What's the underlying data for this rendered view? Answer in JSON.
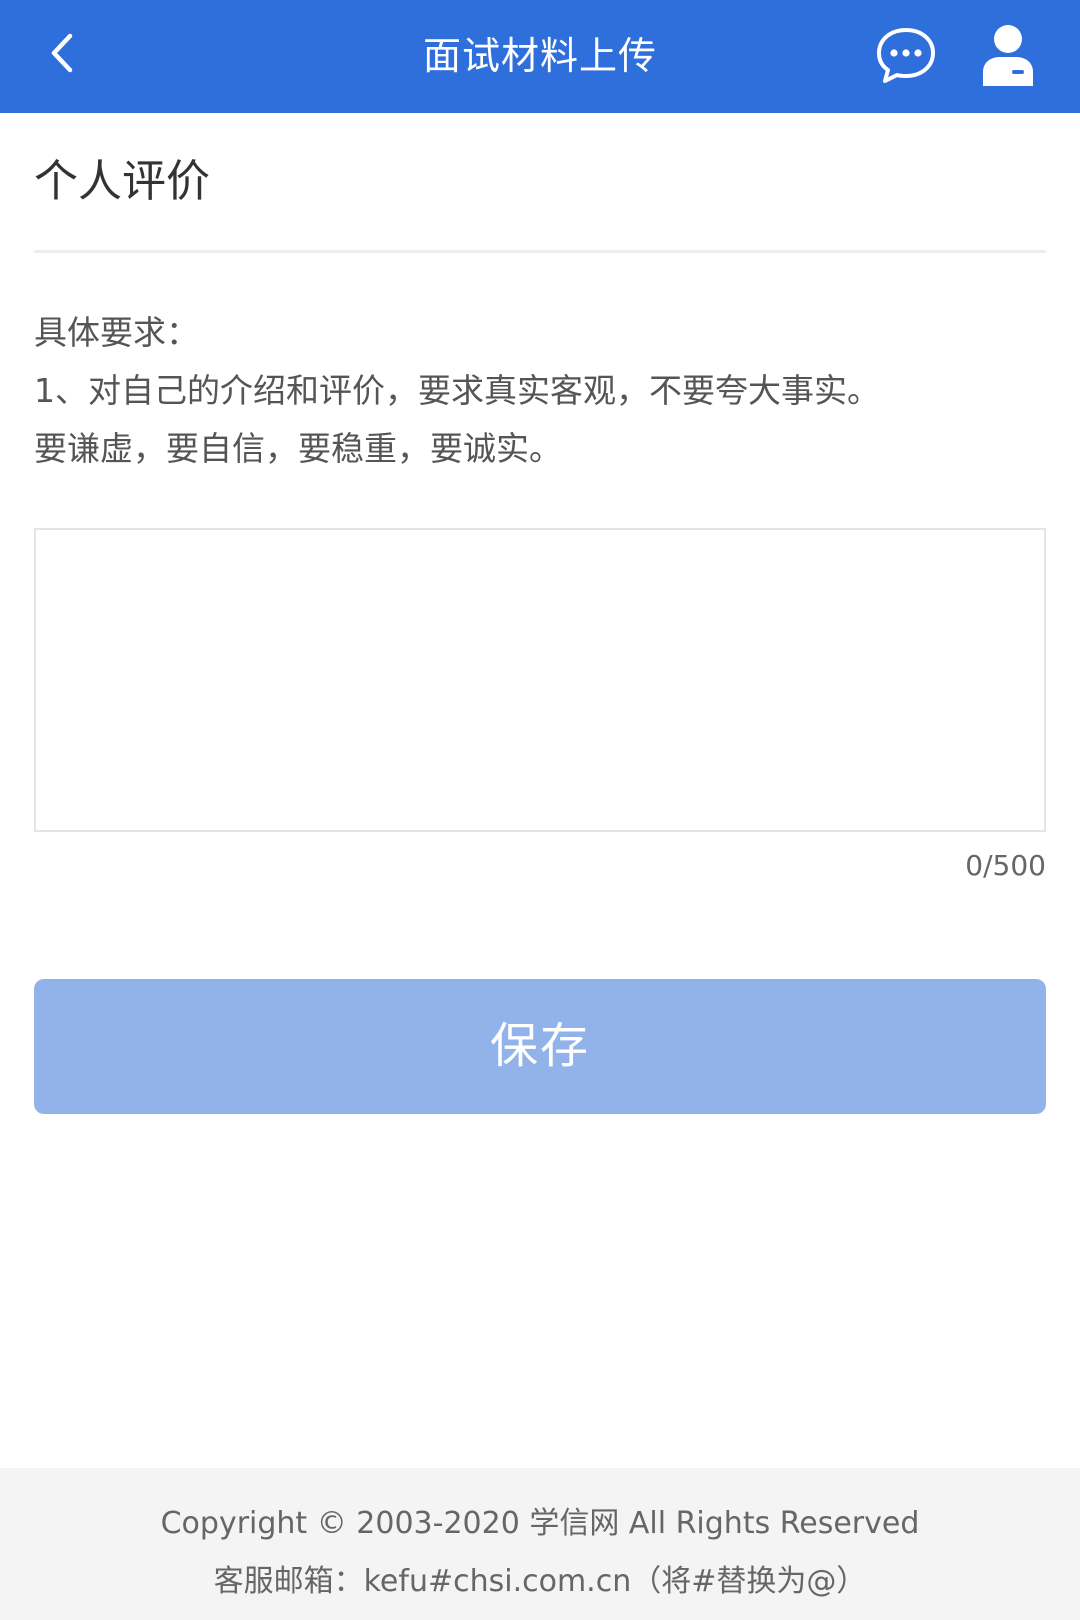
{
  "header": {
    "title": "面试材料上传",
    "background_color": "#2f6fdc",
    "back_icon": "chevron-left-icon",
    "message_icon": "chat-bubble-icon",
    "user_icon": "user-icon"
  },
  "section": {
    "title": "个人评价"
  },
  "requirements": {
    "heading": "具体要求：",
    "lines": [
      "1、对自己的介绍和评价，要求真实客观，不要夸大事实。",
      "要谦虚，要自信，要稳重，要诚实。"
    ]
  },
  "textarea": {
    "value": "",
    "placeholder": ""
  },
  "char_count": "0/500",
  "save_button": {
    "label": "保存",
    "color": "#92b3ea"
  },
  "footer": {
    "copyright": "Copyright © 2003-2020 学信网 All Rights Reserved",
    "contact": "客服邮箱：kefu#chsi.com.cn（将#替换为@）"
  }
}
